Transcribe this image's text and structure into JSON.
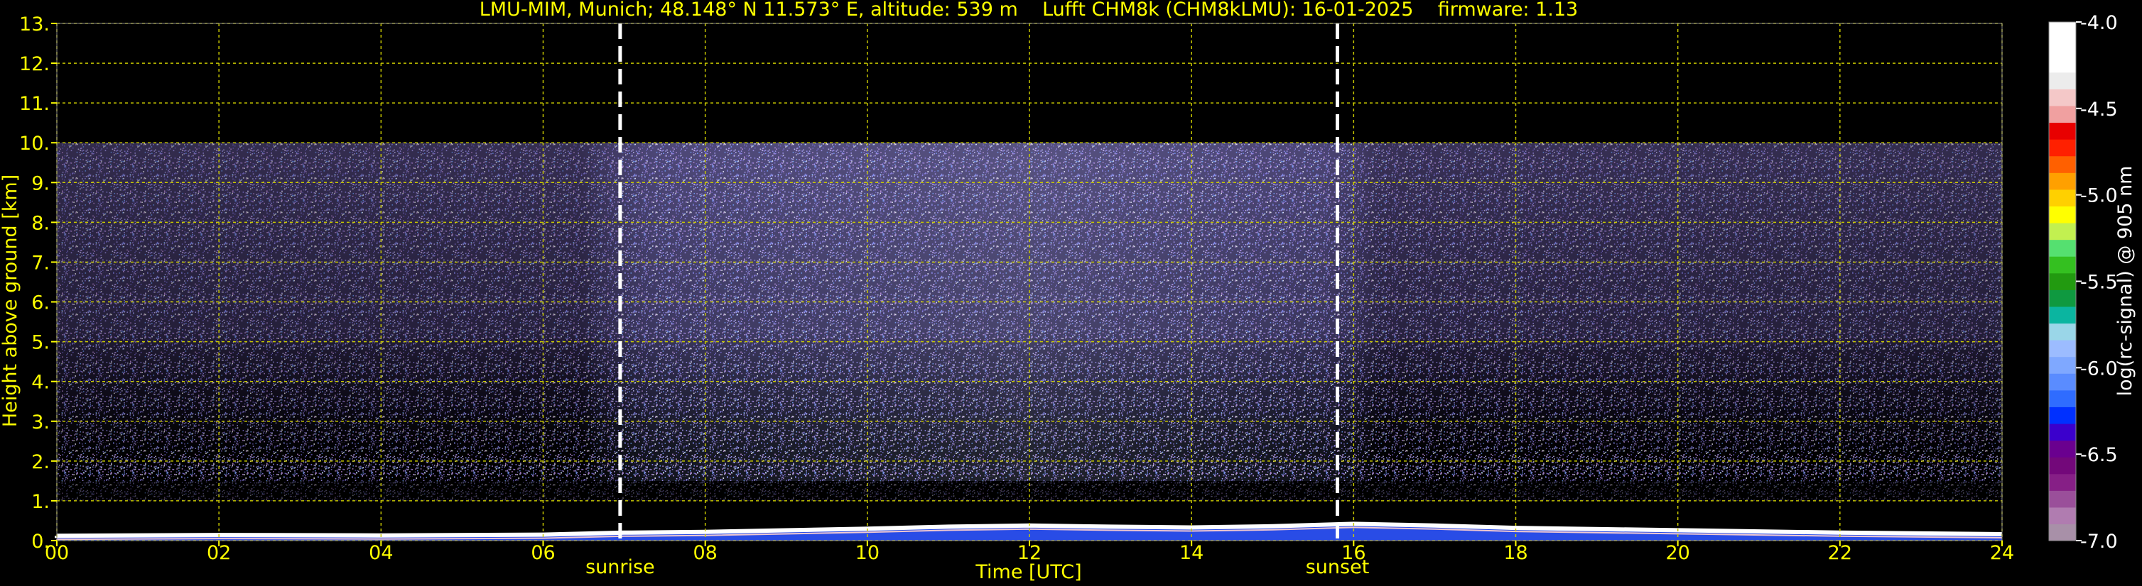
{
  "chart_data": {
    "type": "heatmap",
    "title": "LMU-MIM, Munich; 48.148° N 11.573° E, altitude: 539 m    Lufft CHM8k (CHM8kLMU): 16-01-2025    firmware: 1.13",
    "xlabel": "Time [UTC]",
    "ylabel": "Height above ground [km]",
    "xlim": [
      0,
      24
    ],
    "ylim": [
      0,
      13
    ],
    "x_ticks": [
      "00",
      "02",
      "04",
      "06",
      "08",
      "10",
      "12",
      "14",
      "16",
      "18",
      "20",
      "22",
      "24"
    ],
    "y_ticks": [
      "0.",
      "1.",
      "2.",
      "3.",
      "4.",
      "5.",
      "6.",
      "7.",
      "8.",
      "9.",
      "10.",
      "11.",
      "12.",
      "13."
    ],
    "grid": true,
    "signal_top_km": 10,
    "markers": [
      {
        "name": "sunrise",
        "time": 6.95
      },
      {
        "name": "sunset",
        "time": 15.8
      }
    ],
    "colorbar": {
      "label": "log(rc-signal) @ 905 nm",
      "range": [
        -7.0,
        -4.0
      ],
      "ticks": [
        "-4.0",
        "-4.5",
        "-5.0",
        "-5.5",
        "-6.0",
        "-6.5",
        "-7.0"
      ],
      "tick_values": [
        -4.0,
        -4.5,
        -5.0,
        -5.5,
        -6.0,
        -6.5,
        -7.0
      ],
      "colors": [
        "#a890a8",
        "#b07cb0",
        "#9a4f9a",
        "#861f86",
        "#73087a",
        "#6a008f",
        "#3b00cc",
        "#0030ff",
        "#2f6cff",
        "#5a8cff",
        "#7fa8ff",
        "#9cbcff",
        "#9ad6e8",
        "#0bb5a0",
        "#0f9940",
        "#229a10",
        "#34c020",
        "#55e070",
        "#c2f050",
        "#ffff00",
        "#ffd000",
        "#ffa000",
        "#ff6000",
        "#ff2000",
        "#e80000",
        "#f0a0a0",
        "#f4c8c8",
        "#ececec",
        "#ffffff",
        "#ffffff",
        "#ffffff"
      ]
    }
  }
}
